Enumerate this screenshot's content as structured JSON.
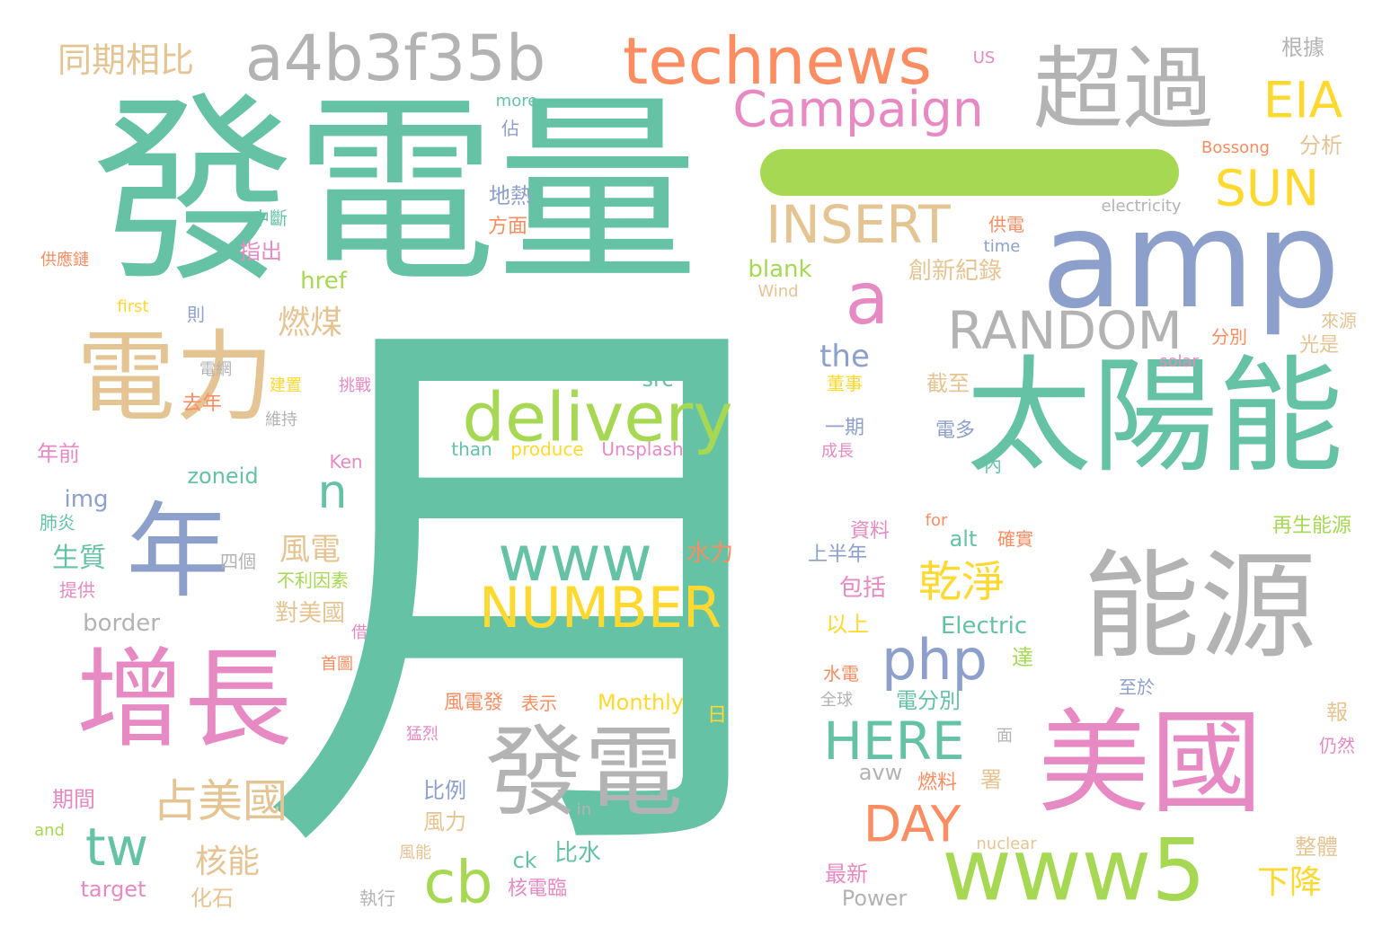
{
  "colors": {
    "teal": "#66c2a5",
    "orange": "#fc8d62",
    "blue": "#8da0cb",
    "pink": "#e78ac3",
    "green": "#a6d854",
    "yellow": "#ffd92f",
    "tan": "#e5c494",
    "gray": "#b3b3b3"
  },
  "words": [
    {
      "text": "月",
      "color": "teal"
    },
    {
      "text": "發電量",
      "color": "teal"
    },
    {
      "text": "amp",
      "color": "blue"
    },
    {
      "text": "太陽能",
      "color": "teal"
    },
    {
      "text": "能源",
      "color": "gray"
    },
    {
      "text": "美國",
      "color": "pink"
    },
    {
      "text": "增長",
      "color": "pink"
    },
    {
      "text": "電力",
      "color": "tan"
    },
    {
      "text": "年",
      "color": "blue"
    },
    {
      "text": "發電",
      "color": "gray"
    },
    {
      "text": "超過",
      "color": "gray"
    },
    {
      "text": "technews",
      "color": "orange"
    },
    {
      "text": "a4b3f35b",
      "color": "gray"
    },
    {
      "text": "www5",
      "color": "green"
    },
    {
      "text": "delivery",
      "color": "green"
    },
    {
      "text": "www",
      "color": "teal"
    },
    {
      "text": "NUMBER",
      "color": "yellow"
    },
    {
      "text": "Campaign",
      "color": "pink"
    },
    {
      "text": "INSERT",
      "color": "tan"
    },
    {
      "text": "RANDOM",
      "color": "gray"
    },
    {
      "text": "a",
      "color": "pink"
    },
    {
      "text": "php",
      "color": "blue"
    },
    {
      "text": "HERE",
      "color": "teal"
    },
    {
      "text": "SUN",
      "color": "yellow"
    },
    {
      "text": "EIA",
      "color": "yellow"
    },
    {
      "text": "DAY",
      "color": "orange"
    },
    {
      "text": "cb",
      "color": "green"
    },
    {
      "text": "tw",
      "color": "teal"
    },
    {
      "text": "n",
      "color": "teal"
    },
    {
      "text": "占美國",
      "color": "tan"
    },
    {
      "text": "乾淨",
      "color": "yellow"
    },
    {
      "text": "同期相比",
      "color": "tan"
    },
    {
      "text": "燃煤",
      "color": "tan"
    },
    {
      "text": "核能",
      "color": "tan"
    },
    {
      "text": "下降",
      "color": "yellow"
    },
    {
      "text": "風電",
      "color": "tan"
    },
    {
      "text": "the",
      "color": "blue"
    },
    {
      "text": "創新紀錄",
      "color": "tan"
    },
    {
      "text": "根據",
      "color": "gray"
    },
    {
      "text": "分析",
      "color": "tan"
    },
    {
      "text": "Bossong",
      "color": "orange"
    },
    {
      "text": "electricity",
      "color": "gray"
    },
    {
      "text": "US",
      "color": "pink"
    },
    {
      "text": "more",
      "color": "teal"
    },
    {
      "text": "佔",
      "color": "blue"
    },
    {
      "text": "地熱",
      "color": "blue"
    },
    {
      "text": "方面",
      "color": "orange"
    },
    {
      "text": "中斷",
      "color": "teal"
    },
    {
      "text": "指出",
      "color": "pink"
    },
    {
      "text": "供應鏈",
      "color": "orange"
    },
    {
      "text": "供電",
      "color": "orange"
    },
    {
      "text": "time",
      "color": "blue"
    },
    {
      "text": "Wind",
      "color": "tan"
    },
    {
      "text": "href",
      "color": "green"
    },
    {
      "text": "blank",
      "color": "green"
    },
    {
      "text": "first",
      "color": "yellow"
    },
    {
      "text": "則",
      "color": "blue"
    },
    {
      "text": "來源",
      "color": "tan"
    },
    {
      "text": "分別",
      "color": "orange"
    },
    {
      "text": "光是",
      "color": "tan"
    },
    {
      "text": "solar",
      "color": "pink"
    },
    {
      "text": "電網",
      "color": "gray"
    },
    {
      "text": "建置",
      "color": "yellow"
    },
    {
      "text": "挑戰",
      "color": "pink"
    },
    {
      "text": "src",
      "color": "teal"
    },
    {
      "text": "董事",
      "color": "yellow"
    },
    {
      "text": "截至",
      "color": "tan"
    },
    {
      "text": "去年",
      "color": "orange"
    },
    {
      "text": "維持",
      "color": "gray"
    },
    {
      "text": "電多",
      "color": "blue"
    },
    {
      "text": "一期",
      "color": "blue"
    },
    {
      "text": "成長",
      "color": "pink"
    },
    {
      "text": "年前",
      "color": "pink"
    },
    {
      "text": "than",
      "color": "teal"
    },
    {
      "text": "produce",
      "color": "yellow"
    },
    {
      "text": "Unsplash",
      "color": "pink"
    },
    {
      "text": "Ken",
      "color": "pink"
    },
    {
      "text": "內",
      "color": "teal"
    },
    {
      "text": "zoneid",
      "color": "teal"
    },
    {
      "text": "img",
      "color": "blue"
    },
    {
      "text": "資料",
      "color": "pink"
    },
    {
      "text": "for",
      "color": "orange"
    },
    {
      "text": "肺炎",
      "color": "teal"
    },
    {
      "text": "alt",
      "color": "teal"
    },
    {
      "text": "確實",
      "color": "orange"
    },
    {
      "text": "再生能源",
      "color": "green"
    },
    {
      "text": "生質",
      "color": "teal"
    },
    {
      "text": "四個",
      "color": "gray"
    },
    {
      "text": "水力",
      "color": "orange"
    },
    {
      "text": "上半年",
      "color": "blue"
    },
    {
      "text": "不利因素",
      "color": "green"
    },
    {
      "text": "提供",
      "color": "pink"
    },
    {
      "text": "包括",
      "color": "pink"
    },
    {
      "text": "對美國",
      "color": "tan"
    },
    {
      "text": "border",
      "color": "gray"
    },
    {
      "text": "以上",
      "color": "yellow"
    },
    {
      "text": "Electric",
      "color": "teal"
    },
    {
      "text": "借",
      "color": "pink"
    },
    {
      "text": "首圖",
      "color": "orange"
    },
    {
      "text": "達",
      "color": "green"
    },
    {
      "text": "水電",
      "color": "orange"
    },
    {
      "text": "至於",
      "color": "blue"
    },
    {
      "text": "全球",
      "color": "gray"
    },
    {
      "text": "電分別",
      "color": "teal"
    },
    {
      "text": "風電發",
      "color": "orange"
    },
    {
      "text": "表示",
      "color": "orange"
    },
    {
      "text": "Monthly",
      "color": "yellow"
    },
    {
      "text": "日",
      "color": "yellow"
    },
    {
      "text": "猛烈",
      "color": "pink"
    },
    {
      "text": "面",
      "color": "gray"
    },
    {
      "text": "報",
      "color": "tan"
    },
    {
      "text": "仍然",
      "color": "pink"
    },
    {
      "text": "avw",
      "color": "gray"
    },
    {
      "text": "期間",
      "color": "pink"
    },
    {
      "text": "比例",
      "color": "blue"
    },
    {
      "text": "燃料",
      "color": "orange"
    },
    {
      "text": "署",
      "color": "tan"
    },
    {
      "text": "in",
      "color": "gray"
    },
    {
      "text": "風力",
      "color": "tan"
    },
    {
      "text": "and",
      "color": "green"
    },
    {
      "text": "風能",
      "color": "tan"
    },
    {
      "text": "nuclear",
      "color": "tan"
    },
    {
      "text": "比水",
      "color": "teal"
    },
    {
      "text": "ck",
      "color": "teal"
    },
    {
      "text": "整體",
      "color": "tan"
    },
    {
      "text": "target",
      "color": "pink"
    },
    {
      "text": "最新",
      "color": "pink"
    },
    {
      "text": "核電臨",
      "color": "pink"
    },
    {
      "text": "化石",
      "color": "tan"
    },
    {
      "text": "執行",
      "color": "gray"
    },
    {
      "text": "Power",
      "color": "gray"
    }
  ]
}
